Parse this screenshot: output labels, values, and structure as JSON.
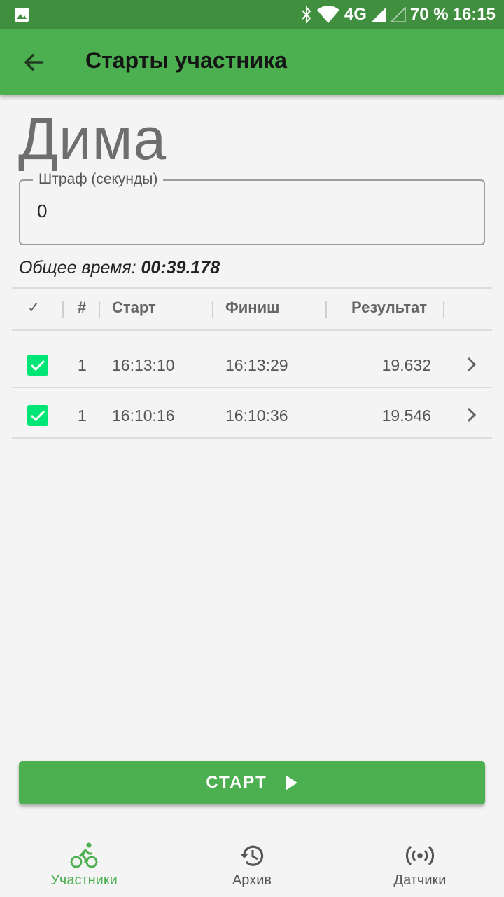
{
  "status_bar": {
    "network": "4G",
    "battery": "70 %",
    "time": "16:15"
  },
  "app_bar": {
    "title": "Старты участника",
    "back_icon": "arrow-back-icon"
  },
  "participant": {
    "name": "Дима"
  },
  "penalty": {
    "label": "Штраф (секунды)",
    "value": "0"
  },
  "total": {
    "label": "Общее время:",
    "value": "00:39.178"
  },
  "table": {
    "headers": {
      "check": "✓",
      "number": "#",
      "start": "Старт",
      "finish": "Финиш",
      "result": "Результат"
    },
    "rows": [
      {
        "checked": true,
        "number": "1",
        "start": "16:13:10",
        "finish": "16:13:29",
        "result": "19.632"
      },
      {
        "checked": true,
        "number": "1",
        "start": "16:10:16",
        "finish": "16:10:36",
        "result": "19.546"
      }
    ]
  },
  "start_button": {
    "label": "СТАРТ"
  },
  "bottom_nav": {
    "items": [
      {
        "label": "Участники",
        "icon": "bicycle-icon",
        "active": true
      },
      {
        "label": "Архив",
        "icon": "history-icon",
        "active": false
      },
      {
        "label": "Датчики",
        "icon": "sensors-icon",
        "active": false
      }
    ]
  },
  "colors": {
    "primary": "#4caf50",
    "status_bar": "#3f8f3f",
    "checkbox": "#00e676"
  }
}
